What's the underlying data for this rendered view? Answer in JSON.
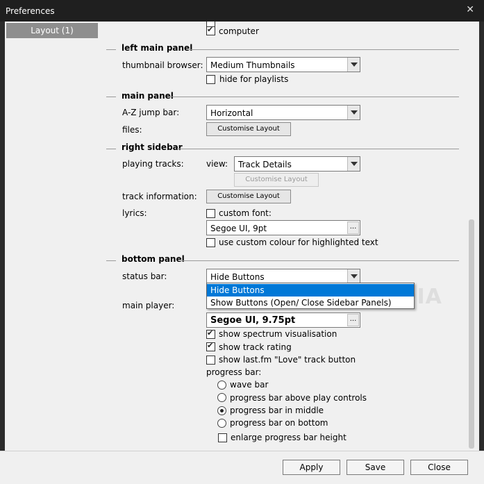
{
  "window": {
    "title": "Preferences",
    "close_glyph": "✕"
  },
  "sidebar": {
    "items": [
      {
        "label": "Layout (1)"
      }
    ]
  },
  "top": {
    "computer_label": "computer"
  },
  "left_main_panel": {
    "header": "left main panel",
    "thumbnail_browser_label": "thumbnail browser:",
    "thumbnail_browser_value": "Medium Thumbnails",
    "hide_for_playlists_label": "hide for playlists"
  },
  "main_panel": {
    "header": "main panel",
    "az_jump_bar_label": "A-Z jump bar:",
    "az_jump_bar_value": "Horizontal",
    "files_label": "files:",
    "customise_layout_label": "Customise Layout"
  },
  "right_sidebar": {
    "header": "right sidebar",
    "playing_tracks_label": "playing tracks:",
    "view_label": "view:",
    "view_value": "Track Details",
    "customise_layout_label": "Customise Layout",
    "track_information_label": "track information:",
    "track_info_customise_label": "Customise Layout",
    "lyrics_label": "lyrics:",
    "custom_font_label": "custom font:",
    "lyrics_font_value": "Segoe UI, 9pt",
    "dots_label": "...",
    "custom_colour_label": "use custom colour for highlighted text"
  },
  "bottom_panel": {
    "header": "bottom panel",
    "status_bar_label": "status bar:",
    "status_bar_value": "Hide Buttons",
    "status_bar_options": [
      "Hide Buttons",
      "Show Buttons (Open/ Close Sidebar Panels)"
    ],
    "main_player_label": "main player:",
    "main_player_font_value": "Segoe UI, 9.75pt",
    "dots_label": "...",
    "show_spectrum_label": "show spectrum visualisation",
    "show_track_rating_label": "show track rating",
    "show_lastfm_label": "show last.fm \"Love\" track button",
    "progress_bar_label": "progress bar:",
    "progress_options": [
      "wave bar",
      "progress bar above play controls",
      "progress bar in middle",
      "progress bar on bottom"
    ],
    "enlarge_label": "enlarge progress bar height"
  },
  "watermark": "SOFTPEDIA",
  "footer": {
    "apply_label": "Apply",
    "save_label": "Save",
    "close_label": "Close"
  }
}
